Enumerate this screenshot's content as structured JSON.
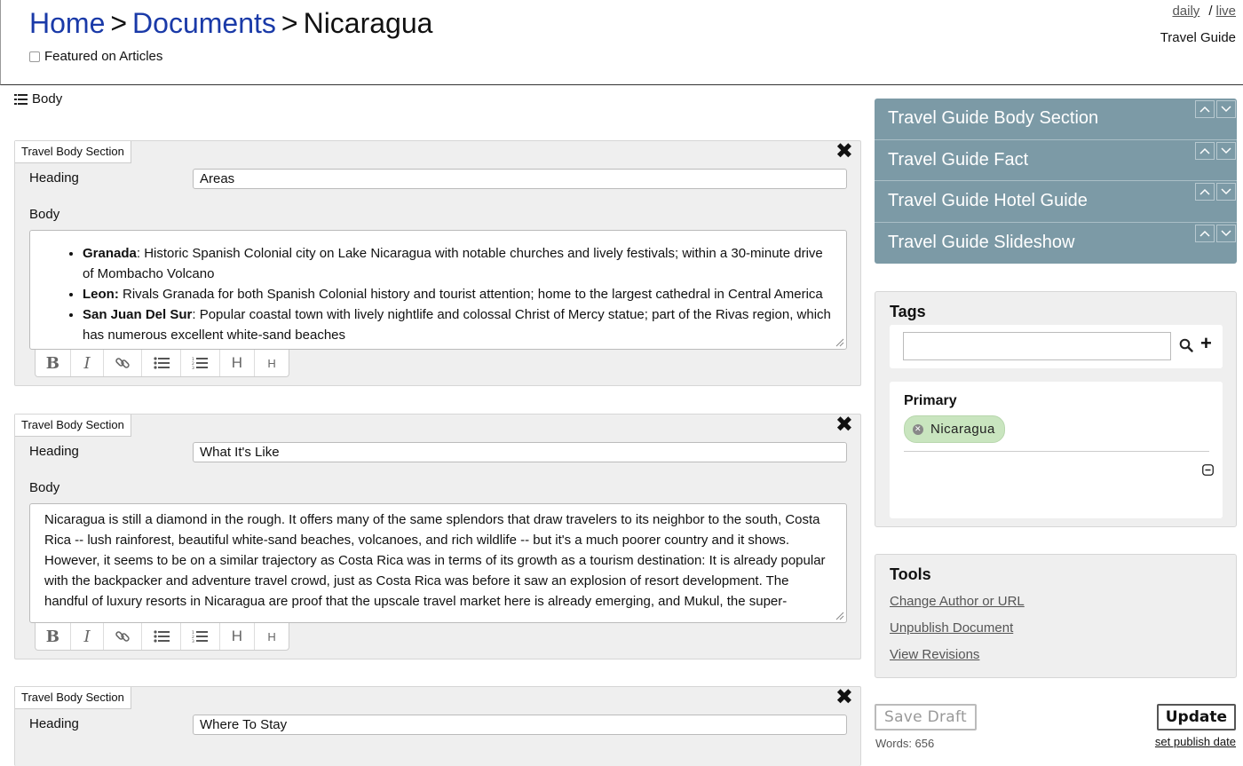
{
  "header": {
    "breadcrumb": [
      {
        "label": "Home"
      },
      {
        "label": "Documents"
      },
      {
        "label": "Nicaragua"
      }
    ],
    "separator": ">",
    "featured_label": "Featured on Articles",
    "featured_checked": false,
    "env_links": {
      "daily": "daily",
      "slash": "/",
      "live": "live"
    },
    "doc_type": "Travel Guide"
  },
  "body_label": "Body",
  "sections": [
    {
      "tag": "Travel Body Section",
      "heading_label": "Heading",
      "heading_value": "Areas",
      "body_label": "Body",
      "body_items": [
        {
          "bold": "Granada",
          "text": ": Historic Spanish Colonial city on Lake Nicaragua with notable churches and lively festivals; within a 30-minute drive of Mombacho Volcano"
        },
        {
          "bold": "Leon:",
          "text": " Rivals Granada for both Spanish Colonial history and tourist attention; home to the largest cathedral in Central America"
        },
        {
          "bold": "San Juan Del Sur",
          "text": ": Popular coastal town with lively nightlife and colossal Christ of Mercy statue; part of the Rivas region, which has numerous excellent white-sand beaches"
        }
      ]
    },
    {
      "tag": "Travel Body Section",
      "heading_label": "Heading",
      "heading_value": "What It's Like",
      "body_label": "Body",
      "body_text": "Nicaragua is still a diamond in the rough. It offers many of the same splendors that draw travelers to its neighbor to the south, Costa Rica -- lush rainforest, beautiful white-sand beaches, volcanoes, and rich wildlife -- but it's a much poorer country and it shows. However, it seems to be on a similar trajectory as Costa Rica was in terms of its growth as a tourism destination: It is already popular with the backpacker and adventure travel crowd, just as Costa Rica was before it saw an explosion of resort development. The handful of luxury resorts in Nicaragua are proof that the upscale travel market here is already emerging, and Mukul, the super-"
    },
    {
      "tag": "Travel Body Section",
      "heading_label": "Heading",
      "heading_value": "Where To Stay"
    }
  ],
  "toolbar": {
    "buttons": [
      "bold-button",
      "italic-button",
      "link-button",
      "bullet-list-button",
      "numbered-list-button",
      "heading-large-button",
      "heading-small-button"
    ],
    "heading_large": "H",
    "heading_small": "H"
  },
  "widgets": [
    {
      "label": "Travel Guide Body Section"
    },
    {
      "label": "Travel Guide Fact"
    },
    {
      "label": "Travel Guide Hotel Guide"
    },
    {
      "label": "Travel Guide Slideshow"
    }
  ],
  "tags": {
    "title": "Tags",
    "input_value": "",
    "primary_label": "Primary",
    "primary_tags": [
      "Nicaragua"
    ]
  },
  "tools": {
    "title": "Tools",
    "links": [
      "Change Author or URL",
      "Unpublish Document",
      "View Revisions"
    ]
  },
  "actions": {
    "save_draft": "Save Draft",
    "update": "Update",
    "word_count": "Words: 656",
    "set_publish_date": "set publish date"
  },
  "colors": {
    "link_blue": "#1a3aa8",
    "widget_bg": "#7c9aa6",
    "tag_green": "#c9e5bf",
    "panel_bg": "#efefef"
  }
}
